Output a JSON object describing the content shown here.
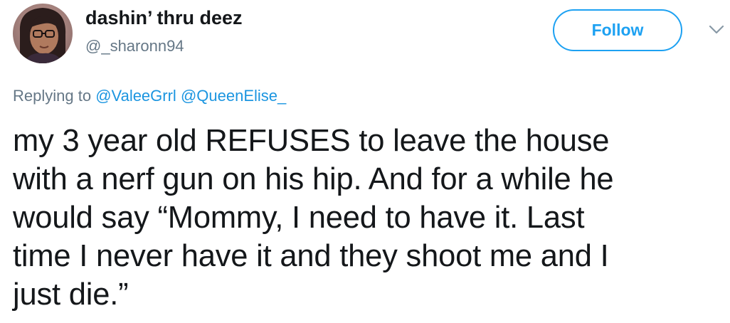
{
  "author": {
    "display_name": "dashin’ thru deez",
    "handle": "@_sharonn94"
  },
  "follow_button": {
    "label": "Follow"
  },
  "reply": {
    "prefix": "Replying to",
    "mentions": [
      "@ValeeGrrl",
      "@QueenElise_"
    ]
  },
  "tweet": {
    "lines": [
      "my 3 year old REFUSES to leave the house",
      "with a nerf gun on his hip. And for a while he",
      "would say “Mommy, I need to have it. Last",
      "time I never have it and they shoot me and I",
      "just die.”"
    ]
  },
  "colors": {
    "accent": "#1da1f2",
    "mention": "#1b95e0",
    "secondary_text": "#657786",
    "primary_text": "#14171a"
  },
  "icons": {
    "avatar": "user-avatar",
    "caret": "chevron-down-icon"
  }
}
